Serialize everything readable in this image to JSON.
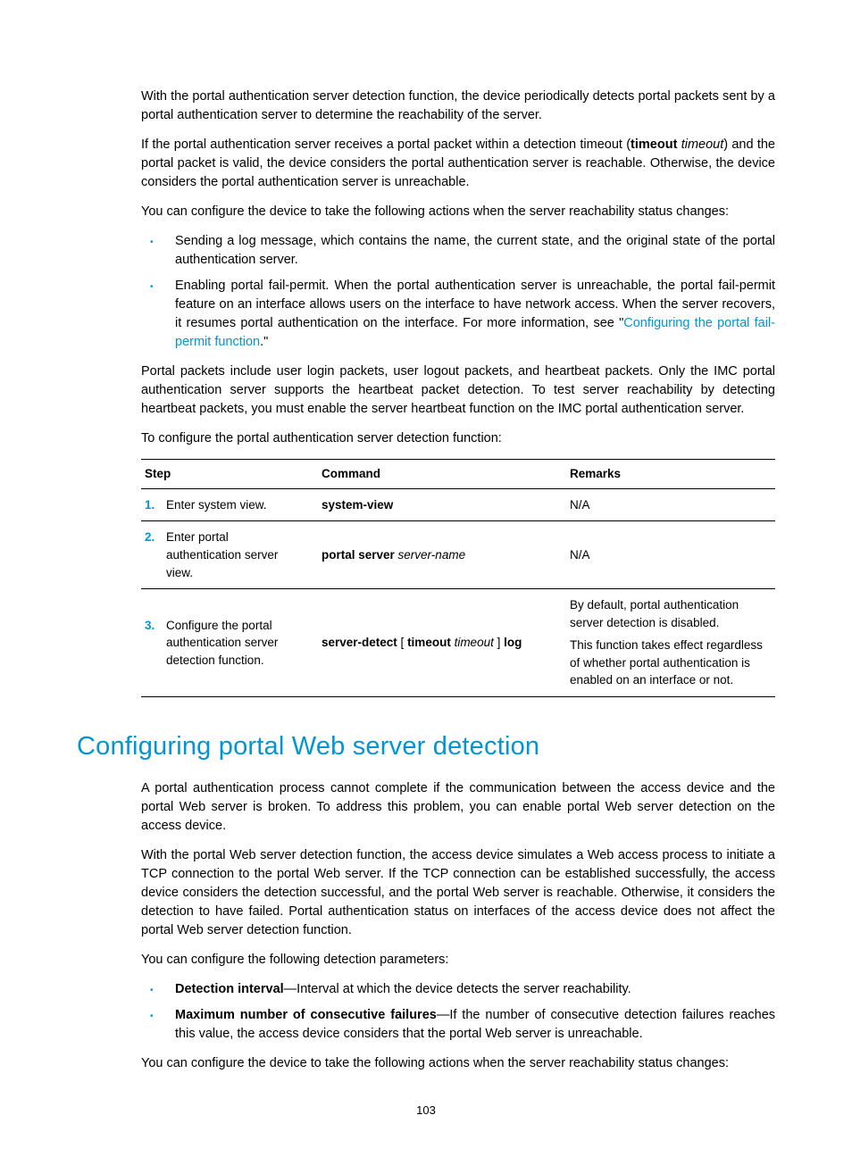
{
  "intro": {
    "p1": "With the portal authentication server detection function, the device periodically detects portal packets sent by a portal authentication server to determine the reachability of the server.",
    "p2a": "If the portal authentication server receives a portal packet within a detection timeout (",
    "p2_bold": "timeout",
    "p2_space": " ",
    "p2_ital": "timeout",
    "p2b": ") and the portal packet is valid, the device considers the portal authentication server is reachable. Otherwise, the device considers the portal authentication server is unreachable.",
    "p3": "You can configure the device to take the following actions when the server reachability status changes:",
    "bullets": [
      {
        "text": "Sending a log message, which contains the name, the current state, and the original state of the portal authentication server."
      },
      {
        "pre": "Enabling portal fail-permit. When the portal authentication server is unreachable, the portal fail-permit feature on an interface allows users on the interface to have network access. When the server recovers, it resumes portal authentication on the interface. For more information, see \"",
        "link": "Configuring the portal fail-permit function",
        "post": ".\""
      }
    ],
    "p4": "Portal packets include user login packets, user logout packets, and heartbeat packets. Only the IMC portal authentication server supports the heartbeat packet detection. To test server reachability by detecting heartbeat packets, you must enable the server heartbeat function on the IMC portal authentication server.",
    "p5": "To configure the portal authentication server detection function:"
  },
  "table": {
    "headers": {
      "step": "Step",
      "command": "Command",
      "remarks": "Remarks"
    },
    "rows": [
      {
        "num": "1.",
        "desc": "Enter system view.",
        "cmd_bold1": "system-view",
        "remarks": "N/A"
      },
      {
        "num": "2.",
        "desc": "Enter portal authentication server view.",
        "cmd_bold1": "portal server",
        "cmd_ital1": " server-name",
        "remarks": "N/A"
      },
      {
        "num": "3.",
        "desc": "Configure the portal authentication server detection function.",
        "cmd_bold1": "server-detect",
        "cmd_plain1": " [ ",
        "cmd_bold2": "timeout",
        "cmd_ital1": " timeout",
        "cmd_plain2": " ] ",
        "cmd_bold3": "log",
        "remarks1": "By default, portal authentication server detection is disabled.",
        "remarks2": "This function takes effect regardless of whether portal authentication is enabled on an interface or not."
      }
    ]
  },
  "section2": {
    "heading": "Configuring portal Web server detection",
    "p1": "A portal authentication process cannot complete if the communication between the access device and the portal Web server is broken. To address this problem, you can enable portal Web server detection on the access device.",
    "p2": "With the portal Web server detection function, the access device simulates a Web access process to initiate a TCP connection to the portal Web server. If the TCP connection can be established successfully, the access device considers the detection successful, and the portal Web server is reachable. Otherwise, it considers the detection to have failed. Portal authentication status on interfaces of the access device does not affect the portal Web server detection function.",
    "p3": "You can configure the following detection parameters:",
    "bullets": [
      {
        "bold": "Detection interval",
        "rest": "—Interval at which the device detects the server reachability."
      },
      {
        "bold": "Maximum number of consecutive failures",
        "rest": "—If the number of consecutive detection failures reaches this value, the access device considers that the portal Web server is unreachable."
      }
    ],
    "p4": "You can configure the device to take the following actions when the server reachability status changes:"
  },
  "pageNumber": "103"
}
